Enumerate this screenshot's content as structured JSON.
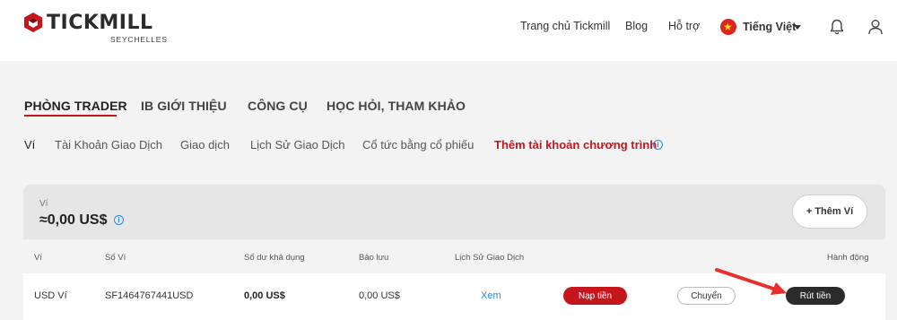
{
  "header": {
    "brand": "TICKMILL",
    "brand_sub": "SEYCHELLES",
    "nav": [
      "Trang chủ Tickmill",
      "Blog",
      "Hỗ trợ"
    ],
    "language": "Tiếng Việt",
    "colors": {
      "brand_red": "#c4161c"
    },
    "icons": [
      "bell-icon",
      "user-icon",
      "vietnam-flag-icon"
    ]
  },
  "main_tabs": [
    {
      "label": "PHÒNG TRADER",
      "active": true
    },
    {
      "label": "IB GIỚI THIỆU",
      "active": false
    },
    {
      "label": "CÔNG CỤ",
      "active": false
    },
    {
      "label": "HỌC HỎI, THAM KHẢO",
      "active": false
    }
  ],
  "sub_tabs": [
    {
      "label": "Ví",
      "active": true
    },
    {
      "label": "Tài Khoản Giao Dịch"
    },
    {
      "label": "Giao dịch"
    },
    {
      "label": "Lịch Sử Giao Dịch"
    },
    {
      "label": "Cổ tức bằng cổ phiếu"
    },
    {
      "label": "Thêm tài khoản chương trình",
      "accent": true
    }
  ],
  "wallet": {
    "label": "Ví",
    "balance": "≈0,00 US$",
    "add_button": "+ Thêm Ví"
  },
  "table": {
    "columns": [
      "Ví",
      "Số Ví",
      "Số dư khả dụng",
      "Bảo lưu",
      "Lịch Sử Giao Dịch",
      "Hành động"
    ],
    "rows": [
      {
        "wallet": "USD Ví",
        "number": "SF1464767441USD",
        "available": "0,00 US$",
        "reserved": "0,00 US$",
        "history": "Xem",
        "actions": {
          "deposit": "Nạp tiền",
          "transfer": "Chuyển",
          "withdraw": "Rút tiền"
        }
      }
    ]
  },
  "annotation": {
    "arrow_color": "#e8302a"
  }
}
